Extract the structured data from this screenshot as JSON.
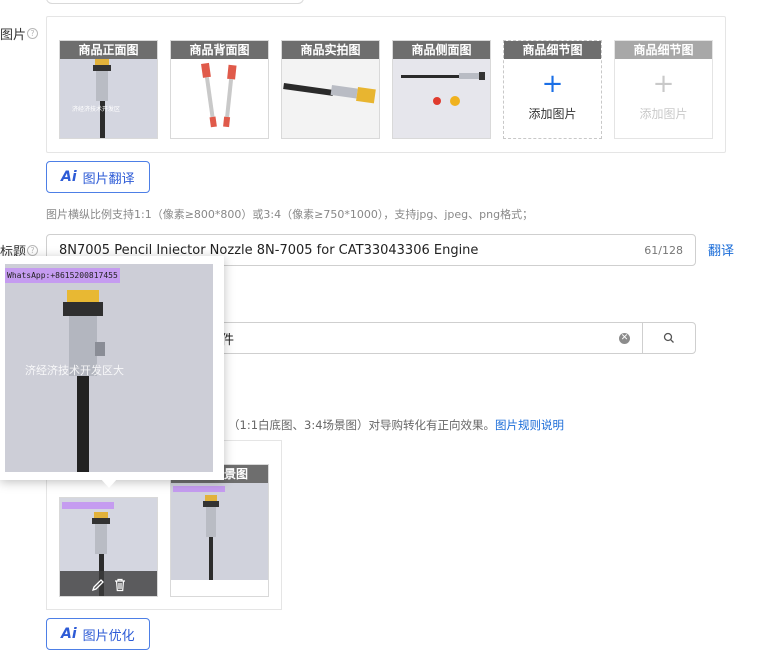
{
  "labels": {
    "images": "图片",
    "title": "标题"
  },
  "image_slots": [
    {
      "label": "商品正面图",
      "type": "photo"
    },
    {
      "label": "商品背面图",
      "type": "photo"
    },
    {
      "label": "商品实拍图",
      "type": "photo"
    },
    {
      "label": "商品侧面图",
      "type": "photo"
    },
    {
      "label": "商品细节图",
      "type": "add",
      "add_label": "添加图片"
    },
    {
      "label": "商品细节图",
      "type": "add_disabled",
      "add_label": "添加图片"
    }
  ],
  "translate_button": {
    "ai": "Ai",
    "label": "图片翻译"
  },
  "image_hint": "图片横纵比例支持1:1（像素≥800*800）或3:4（像素≥750*1000），支持jpg、jpeg、png格式；",
  "title_field": {
    "value": "8N7005 Pencil Iniector Nozzle 8N-7005 for  CAT33043306 Engine",
    "counter": "61/128",
    "translate_link": "翻译"
  },
  "category_field": {
    "value_visible": "件"
  },
  "ratio_hint": {
    "text": "（1:1白底图、3:4场景图）对导购转化有正向效果。",
    "link": "图片规则说明"
  },
  "scene_label_partial": "景图",
  "popup": {
    "watermark_tag": "WhatsApp:+8615200817455",
    "watermark_text": "济经济技术开发区大"
  },
  "optimize_button": {
    "ai": "Ai",
    "label": "图片优化"
  },
  "colors": {
    "accent": "#1a6cd8",
    "tag_bg": "#c59cf0"
  }
}
